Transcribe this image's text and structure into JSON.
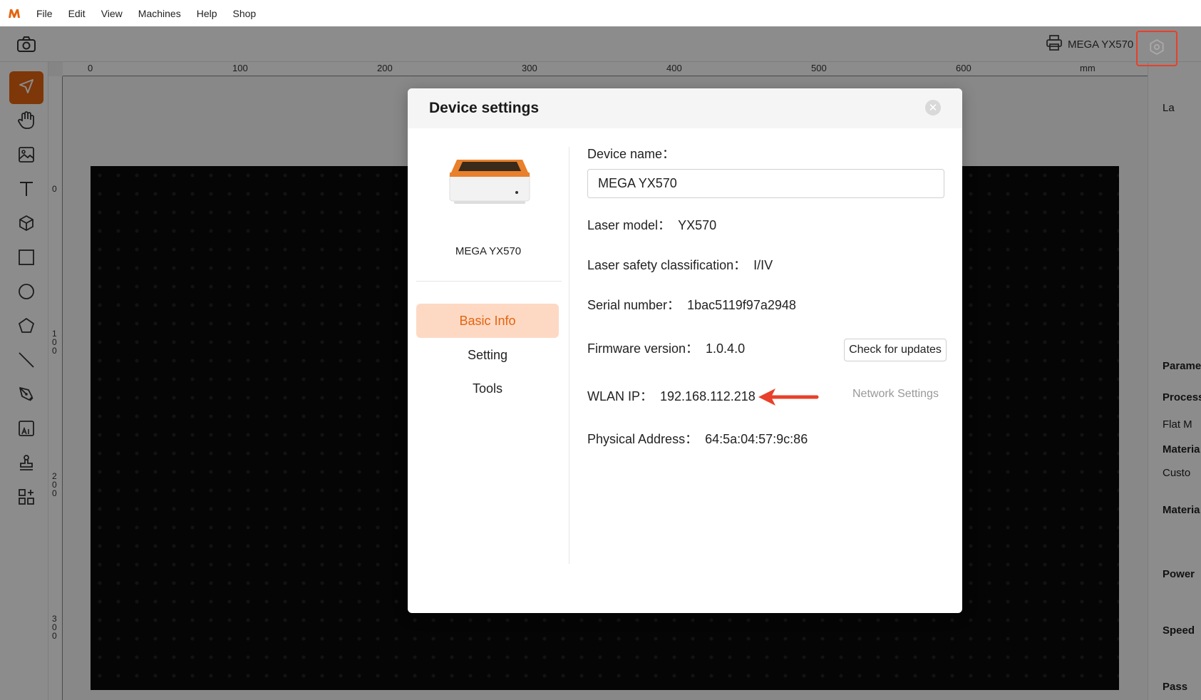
{
  "menubar": {
    "items": [
      "File",
      "Edit",
      "View",
      "Machines",
      "Help",
      "Shop"
    ]
  },
  "toolbar": {
    "device_name": "MEGA YX570"
  },
  "ruler": {
    "top_labels": [
      "0",
      "100",
      "200",
      "300",
      "400",
      "500",
      "600",
      "mm"
    ],
    "left_labels": [
      "0",
      "100",
      "200",
      "300"
    ]
  },
  "right_panel": {
    "labels": [
      "La",
      "Parame",
      "Process",
      "Flat M",
      "Materia",
      "Custo",
      "Materia",
      "Power",
      "Speed",
      "Pass"
    ]
  },
  "dialog": {
    "title": "Device settings",
    "device_image_caption": "MEGA YX570",
    "nav": [
      "Basic Info",
      "Setting",
      "Tools"
    ],
    "fields": {
      "device_name_label": "Device name：",
      "device_name_value": "MEGA YX570",
      "laser_model_label": "Laser model：",
      "laser_model_value": "YX570",
      "safety_label": "Laser safety classification：",
      "safety_value": "I/IV",
      "serial_label": "Serial number：",
      "serial_value": "1bac5119f97a2948",
      "firmware_label": "Firmware version：",
      "firmware_value": "1.0.4.0",
      "check_updates": "Check for updates",
      "wlan_label": "WLAN IP：",
      "wlan_value": "192.168.112.218",
      "network_settings": "Network Settings",
      "mac_label": "Physical Address：",
      "mac_value": "64:5a:04:57:9c:86"
    }
  },
  "colors": {
    "accent": "#e4640f",
    "highlight_box": "#e8402a",
    "nav_active_bg": "#fdd9c4"
  }
}
